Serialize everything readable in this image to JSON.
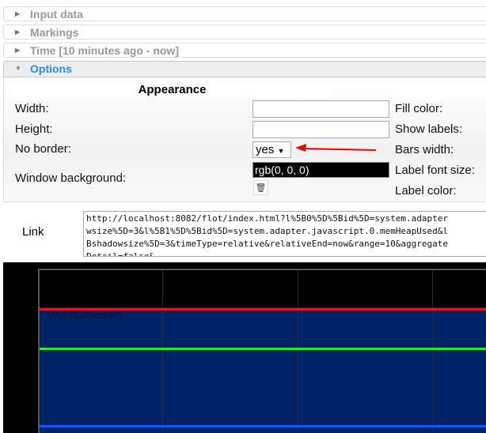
{
  "accordion": [
    {
      "label": "Input data",
      "open": false
    },
    {
      "label": "Markings",
      "open": false
    },
    {
      "label": "Time [10 minutes ago - now]",
      "open": false
    },
    {
      "label": "Options",
      "open": true
    }
  ],
  "options": {
    "appearance_header": "Appearance",
    "width_label": "Width:",
    "width_value": "",
    "height_label": "Height:",
    "height_value": "",
    "no_border_label": "No border:",
    "no_border_value": "yes",
    "window_bg_label": "Window background:",
    "window_bg_value": "rgb(0, 0, 0)",
    "right_labels": [
      "Fill color:",
      "Show labels:",
      "Bars width:",
      "Label font size:",
      "Label color:"
    ]
  },
  "link": {
    "label": "Link",
    "value": "http://localhost:8082/flot/index.html?l%5B0%5D%5Bid%5D=system.adapter\nwsize%5D=3&l%5B1%5D%5Bid%5D=system.adapter.javascript.0.memHeapUsed&l\nBshadowsize%5D=3&timeType=relative&relativeEnd=now&range=10&aggregate\nDetail=false&..."
  },
  "chart": {
    "marking_label": "Wohlfüllbereich",
    "colors": {
      "band": "#002266",
      "red": "#e8102a",
      "green": "#22ee22",
      "blue": "#1155ff"
    }
  }
}
